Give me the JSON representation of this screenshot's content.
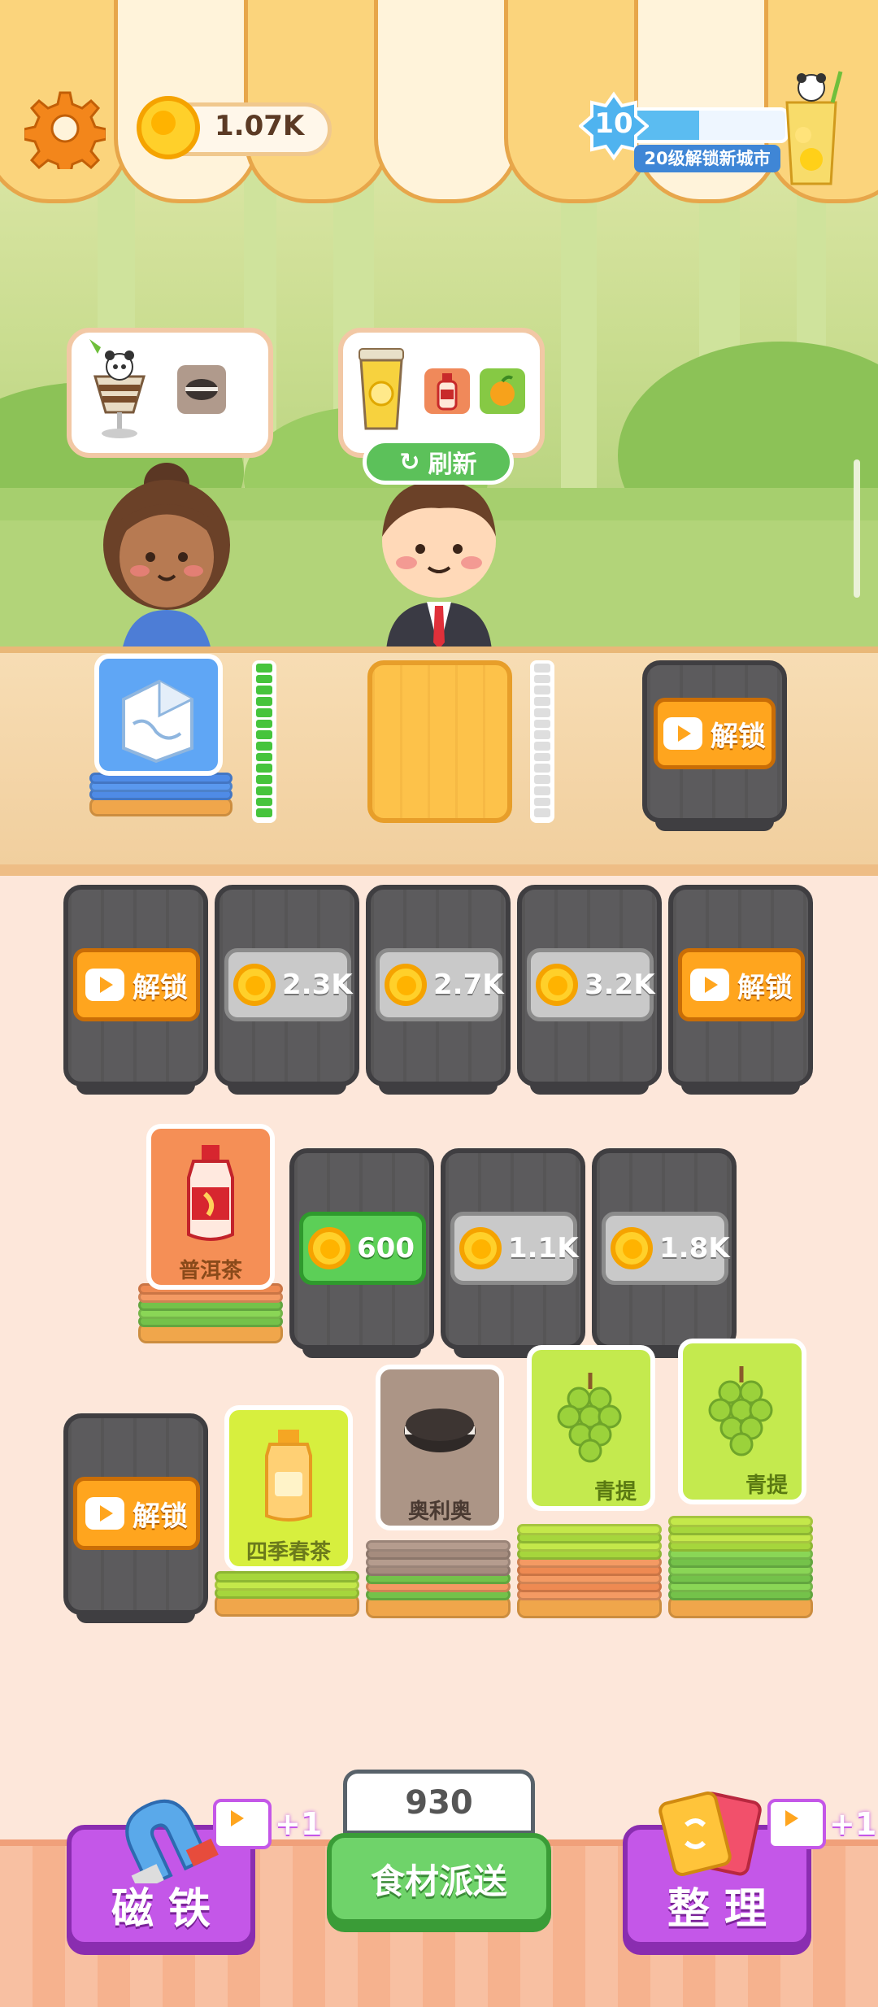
{
  "header": {
    "coins": "1.07K",
    "level": "10",
    "level_progress": 0.45,
    "level_goal": "20级解锁新城市",
    "settings_icon": "gear-icon",
    "jar_icon": "lemon-tea-jar-icon"
  },
  "customers": {
    "left_order": [
      "parfait-icon",
      "oreo-icon"
    ],
    "right_order": [
      "lemon-tea-icon",
      "bottle-icon",
      "orange-icon"
    ],
    "refresh_label": "刷新"
  },
  "counter": {
    "slot1_fill": 14,
    "slot1_total": 14,
    "slot2_fill": 0,
    "slot2_total": 14,
    "unlock_label": "解锁"
  },
  "board": {
    "row1": [
      {
        "type": "unlock",
        "label": "解锁"
      },
      {
        "type": "price",
        "value": "2.3K"
      },
      {
        "type": "price",
        "value": "2.7K"
      },
      {
        "type": "price",
        "value": "3.2K"
      },
      {
        "type": "unlock",
        "label": "解锁"
      }
    ],
    "row2": [
      {
        "type": "card",
        "name": "普洱茶"
      },
      {
        "type": "price",
        "value": "600"
      },
      {
        "type": "price",
        "value": "1.1K"
      },
      {
        "type": "price",
        "value": "1.8K"
      }
    ],
    "row3": [
      {
        "type": "unlock",
        "label": "解锁"
      },
      {
        "type": "card",
        "name": "四季春茶"
      },
      {
        "type": "card",
        "name": "奥利奥"
      },
      {
        "type": "card",
        "name": "青提"
      },
      {
        "type": "card",
        "name": "青提"
      }
    ]
  },
  "bottom": {
    "magnet_label": "磁 铁",
    "magnet_bonus": "+1",
    "dispatch_count": "930",
    "dispatch_label": "食材派送",
    "sort_label": "整 理",
    "sort_bonus": "+1"
  },
  "colors": {
    "accent_orange": "#ffa51e",
    "purple_button": "#c457e8",
    "green_button": "#5ccf57",
    "lock_gray": "#5c5b5d"
  }
}
